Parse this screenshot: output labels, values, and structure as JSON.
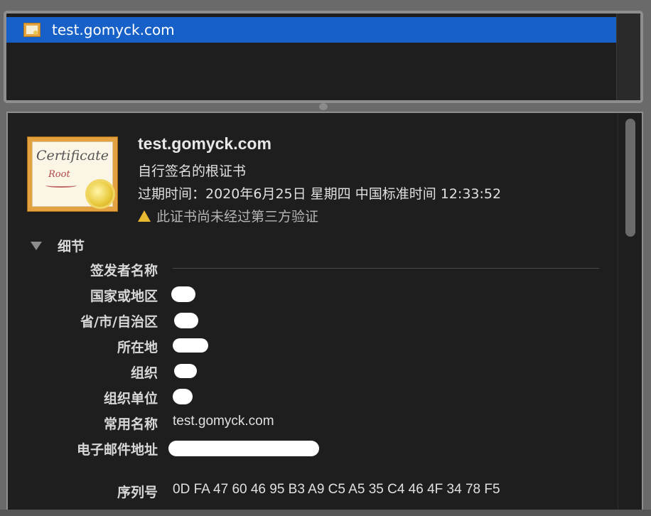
{
  "certificate_list": {
    "items": [
      {
        "label": "test.gomyck.com",
        "icon": "certificate-icon",
        "selected": true
      }
    ]
  },
  "certificate": {
    "name": "test.gomyck.com",
    "kind": "自行签名的根证书",
    "expiry": "过期时间：2020年6月25日 星期四 中国标准时间 12:33:52",
    "warning": "此证书尚未经过第三方验证",
    "icon_text": {
      "title": "Certificate",
      "subtitle": "Root"
    }
  },
  "details": {
    "toggle_label": "细节",
    "issuer_section": "签发者名称",
    "fields": {
      "country": {
        "label": "国家或地区"
      },
      "state": {
        "label": "省/市/自治区"
      },
      "locality": {
        "label": "所在地"
      },
      "organization": {
        "label": "组织"
      },
      "org_unit": {
        "label": "组织单位"
      },
      "common_name": {
        "label": "常用名称",
        "value": "test.gomyck.com"
      },
      "email": {
        "label": "电子邮件地址"
      },
      "serial": {
        "label": "序列号",
        "value": "0D FA 47 60 46 95 B3 A9 C5 A5 35 C4 46 4F 34 78 F5"
      }
    }
  },
  "colors": {
    "selection": "#1660c8",
    "panel_bg": "#1e1e1e",
    "warning": "#e8b830"
  }
}
